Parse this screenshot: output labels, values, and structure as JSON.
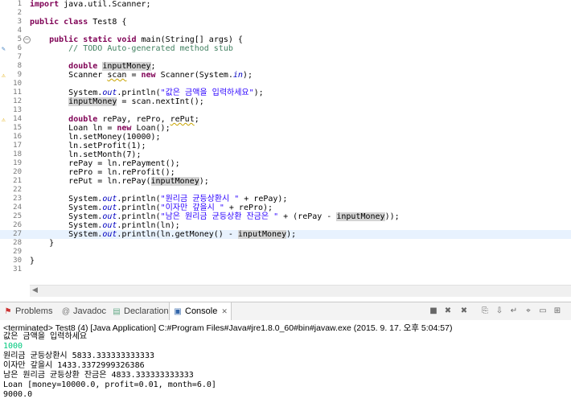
{
  "editor": {
    "line_numbers": [
      "1",
      "2",
      "3",
      "4",
      "5",
      "6",
      "7",
      "8",
      "9",
      "10",
      "11",
      "12",
      "13",
      "14",
      "15",
      "16",
      "17",
      "18",
      "19",
      "20",
      "21",
      "22",
      "23",
      "24",
      "25",
      "26",
      "27",
      "28",
      "29",
      "30",
      "31"
    ],
    "code": {
      "l1_kw": "import",
      "l1_rest": " java.util.Scanner;",
      "l3_kw1": "public",
      "l3_kw2": "class",
      "l3_rest": " Test8 {",
      "l5_indent": "    ",
      "l5_kw1": "public",
      "l5_kw2": "static",
      "l5_kw3": "void",
      "l5_rest": " main(String[] args) {",
      "l6_comment": "        // TODO Auto-generated method stub",
      "l8_indent": "        ",
      "l8_kw": "double",
      "l8_var": "inputMoney",
      "l8_end": ";",
      "l9_a": "        Scanner ",
      "l9_var": "scan",
      "l9_b": " = ",
      "l9_kw": "new",
      "l9_c": " Scanner(System.",
      "l9_fld": "in",
      "l9_d": ");",
      "l11_a": "        System.",
      "l11_fld": "out",
      "l11_b": ".println(",
      "l11_str": "\"값은 금액을 입력하세요\"",
      "l11_c": ");",
      "l12_indent": "        ",
      "l12_var": "inputMoney",
      "l12_rest": " = scan.nextInt();",
      "l14_indent": "        ",
      "l14_kw": "double",
      "l14_rest": " rePay, rePro, ",
      "l14_var": "rePut",
      "l14_end": ";",
      "l15_a": "        Loan ln = ",
      "l15_kw": "new",
      "l15_b": " Loan();",
      "l16": "        ln.setMoney(10000);",
      "l17": "        ln.setProfit(1);",
      "l18": "        ln.setMonth(7);",
      "l19": "        rePay = ln.rePayment();",
      "l20": "        rePro = ln.reProfit();",
      "l21_a": "        rePut = ln.rePay(",
      "l21_var": "inputMoney",
      "l21_b": ");",
      "l23_a": "        System.",
      "l23_fld": "out",
      "l23_b": ".println(",
      "l23_str": "\"원리금 균등상환시 \"",
      "l23_c": " + rePay);",
      "l24_a": "        System.",
      "l24_fld": "out",
      "l24_b": ".println(",
      "l24_str": "\"이자만 갚을시 \"",
      "l24_c": " + rePro);",
      "l25_a": "        System.",
      "l25_fld": "out",
      "l25_b": ".println(",
      "l25_str": "\"남은 원리금 균등상환 잔금은 \"",
      "l25_c": " + (rePay - ",
      "l25_var": "inputMoney",
      "l25_d": "));",
      "l26_a": "        System.",
      "l26_fld": "out",
      "l26_b": ".println(ln);",
      "l27_a": "        System.",
      "l27_fld": "out",
      "l27_b": ".println(ln.getMoney() - ",
      "l27_var": "inputMoney",
      "l27_c": ");",
      "l28": "    }",
      "l30": "}"
    }
  },
  "tabs": {
    "problems": "Problems",
    "javadoc": "Javadoc",
    "declaration": "Declaration",
    "console": "Console"
  },
  "icons": {
    "problems": "problems-icon",
    "javadoc": "at-sign-icon",
    "declaration": "declaration-icon",
    "console": "console-icon"
  },
  "console": {
    "title": "<terminated> Test8 (4) [Java Application] C:#Program Files#Java#jre1.8.0_60#bin#javaw.exe (2015. 9. 17. 오후 5:04:57)",
    "lines": [
      "값은 금액을 입력하세요",
      "1000",
      "원리금 균등상환시 5833.333333333333",
      "이자만 갚을시 1433.3372999326386",
      "남은 원리금 균등상환 잔금은 4833.333333333333",
      "Loan [money=10000.0, profit=0.01, month=6.0]",
      "9000.0"
    ]
  },
  "colors": {
    "keyword": "#7f0055",
    "comment": "#3f7f5f",
    "string": "#2a00ff",
    "field": "#0000c0",
    "console_input": "#00c87d"
  }
}
